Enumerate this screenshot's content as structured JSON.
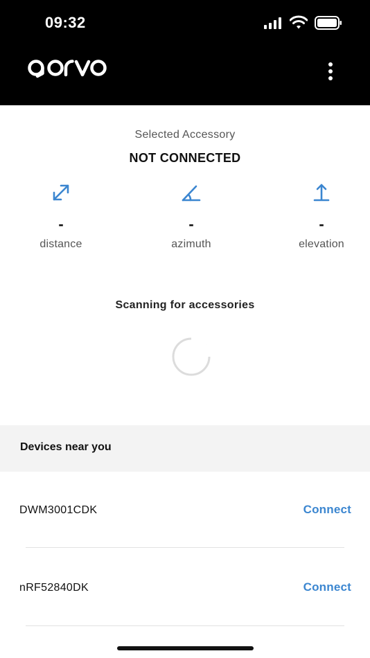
{
  "status_bar": {
    "time": "09:32"
  },
  "header": {
    "logo_text": "qorvo",
    "menu_icon": "more-vertical-icon"
  },
  "accessory": {
    "selected_label": "Selected Accessory",
    "connection_status": "NOT CONNECTED"
  },
  "metrics": [
    {
      "icon": "distance-arrows-icon",
      "value": "-",
      "label": "distance"
    },
    {
      "icon": "azimuth-angle-icon",
      "value": "-",
      "label": "azimuth"
    },
    {
      "icon": "elevation-arrow-icon",
      "value": "-",
      "label": "elevation"
    }
  ],
  "scan": {
    "text": "Scanning for accessories"
  },
  "devices": {
    "title": "Devices near you",
    "items": [
      {
        "name": "DWM3001CDK",
        "action": "Connect"
      },
      {
        "name": "nRF52840DK",
        "action": "Connect"
      }
    ]
  },
  "colors": {
    "accent": "#3b86d0",
    "header_bg": "#000000",
    "section_bg": "#f3f3f3"
  }
}
